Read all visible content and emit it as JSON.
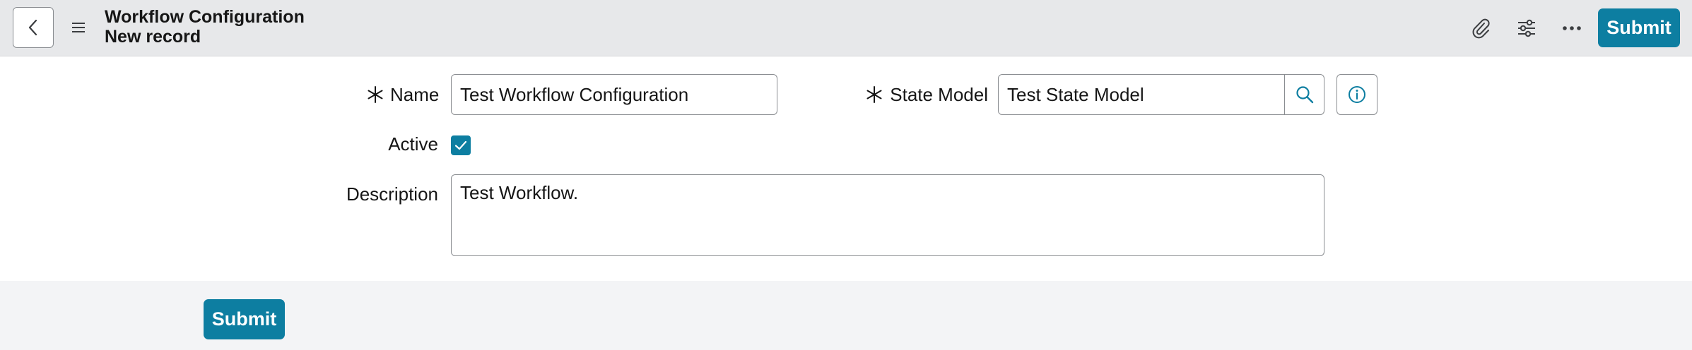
{
  "header": {
    "title": "Workflow Configuration",
    "subtitle": "New record",
    "back_icon": "chevron-left-icon",
    "menu_icon": "hamburger-menu-icon",
    "attachment_icon": "paperclip-icon",
    "settings_icon": "sliders-icon",
    "more_icon": "more-horizontal-icon",
    "submit_label": "Submit"
  },
  "form": {
    "name": {
      "label": "Name",
      "required": true,
      "value": "Test Workflow Configuration"
    },
    "state_model": {
      "label": "State Model",
      "required": true,
      "value": "Test State Model",
      "search_icon": "search-icon",
      "info_icon": "info-icon"
    },
    "active": {
      "label": "Active",
      "checked": true
    },
    "description": {
      "label": "Description",
      "value": "Test Workflow."
    }
  },
  "footer": {
    "submit_label": "Submit"
  },
  "colors": {
    "accent": "#0d7ea1",
    "header_bg": "#e7e8ea",
    "footer_bg": "#f3f4f6"
  }
}
